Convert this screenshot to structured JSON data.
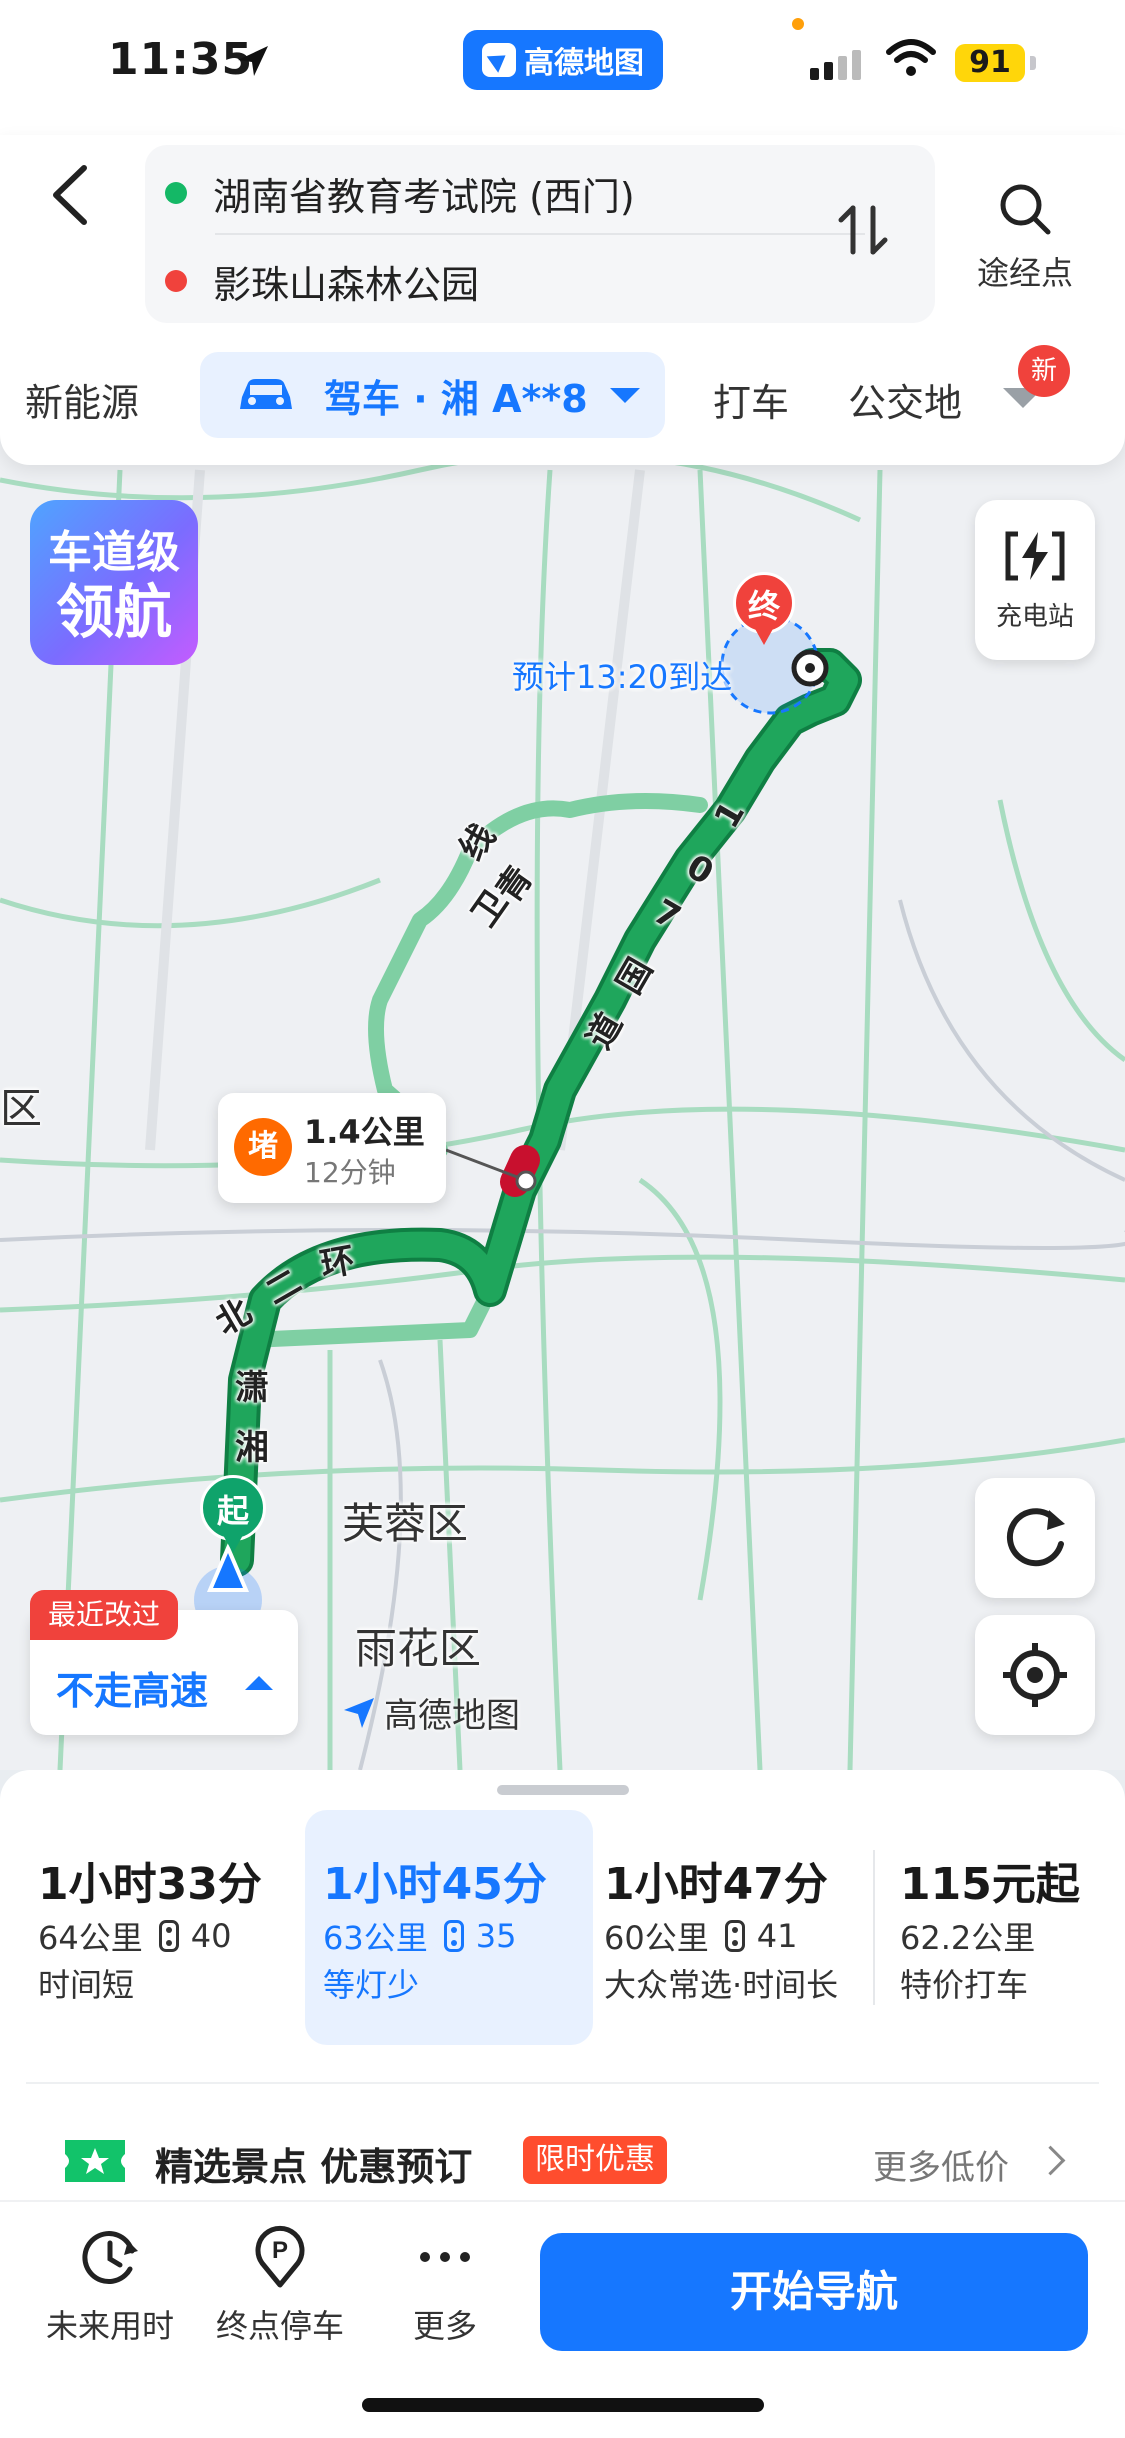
{
  "status_bar": {
    "time": "11:35",
    "app_name": "高德地图",
    "battery": "91"
  },
  "header": {
    "origin": "湖南省教育考试院 (西门)",
    "destination": "影珠山森林公园",
    "waypoint_label": "途经点",
    "modes": {
      "new_energy": "新能源",
      "drive": "驾车 · 湘 A**8",
      "taxi": "打车",
      "transit": "公交地",
      "new_badge": "新"
    }
  },
  "map": {
    "lane_badge": {
      "line1": "车道级",
      "line2": "领航"
    },
    "charging_label": "充电站",
    "eta": "预计13:20到达",
    "end_pin": "终",
    "start_pin": "起",
    "jam": {
      "icon": "堵",
      "distance": "1.4公里",
      "duration": "12分钟"
    },
    "roads": {
      "weiqing": [
        "卫",
        "青",
        "线"
      ],
      "g107": [
        "1",
        "0",
        "7",
        "国",
        "道"
      ],
      "beierhuan": [
        "北",
        "二",
        "环"
      ],
      "xiaoxiang": [
        "潇",
        "湘"
      ]
    },
    "districts": {
      "furong": "芙蓉区",
      "yuhua": "雨花区",
      "left_edge": "区"
    },
    "watermark": "高德地图",
    "recent": {
      "tag": "最近改过",
      "text": "不走高速"
    },
    "colors": {
      "route": "#1fa65c",
      "route_outline": "#0f7f43",
      "alt_route": "#7fcfa3",
      "jam": "#c8102e"
    }
  },
  "options": [
    {
      "time": "1小时33分",
      "distance": "64公里",
      "lights": "40",
      "note": "时间短"
    },
    {
      "time": "1小时45分",
      "distance": "63公里",
      "lights": "35",
      "note": "等灯少"
    },
    {
      "time": "1小时47分",
      "distance": "60公里",
      "lights": "41",
      "note": "大众常选·时间长"
    },
    {
      "time": "115元起",
      "distance": "62.2公里",
      "note": "特价打车"
    }
  ],
  "promo": {
    "title": "精选景点 优惠预订",
    "tag": "限时优惠",
    "more": "更多低价"
  },
  "bottom": {
    "future": "未来用时",
    "parking": "终点停车",
    "more": "更多",
    "start_nav": "开始导航"
  }
}
